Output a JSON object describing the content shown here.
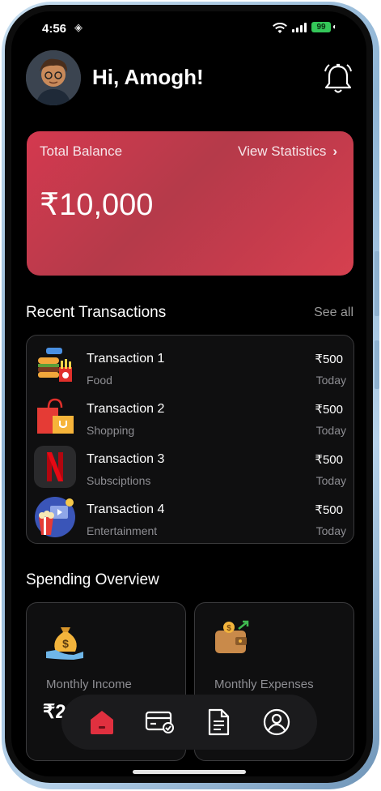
{
  "status_bar": {
    "time": "4:56",
    "battery": "99"
  },
  "header": {
    "greeting": "Hi, Amogh!"
  },
  "balance_card": {
    "label": "Total Balance",
    "link": "View Statistics",
    "amount": "₹10,000"
  },
  "recent": {
    "title": "Recent Transactions",
    "see_all": "See all",
    "items": [
      {
        "name": "Transaction 1",
        "category": "Food",
        "amount": "₹500",
        "date": "Today",
        "icon": "food-icon"
      },
      {
        "name": "Transaction 2",
        "category": "Shopping",
        "amount": "₹500",
        "date": "Today",
        "icon": "shopping-bag-icon"
      },
      {
        "name": "Transaction 3",
        "category": "Subsciptions",
        "amount": "₹500",
        "date": "Today",
        "icon": "netflix-icon"
      },
      {
        "name": "Transaction 4",
        "category": "Entertainment",
        "amount": "₹500",
        "date": "Today",
        "icon": "popcorn-icon"
      }
    ]
  },
  "spending": {
    "title": "Spending Overview",
    "income": {
      "label": "Monthly Income",
      "value": "₹2"
    },
    "expenses": {
      "label": "Monthly Expenses"
    }
  },
  "nav": {
    "items": [
      "home-icon",
      "card-icon",
      "document-icon",
      "profile-icon"
    ],
    "active": "home-icon"
  },
  "colors": {
    "accent": "#d4394f",
    "background": "#000000",
    "card": "#0f0f10"
  }
}
